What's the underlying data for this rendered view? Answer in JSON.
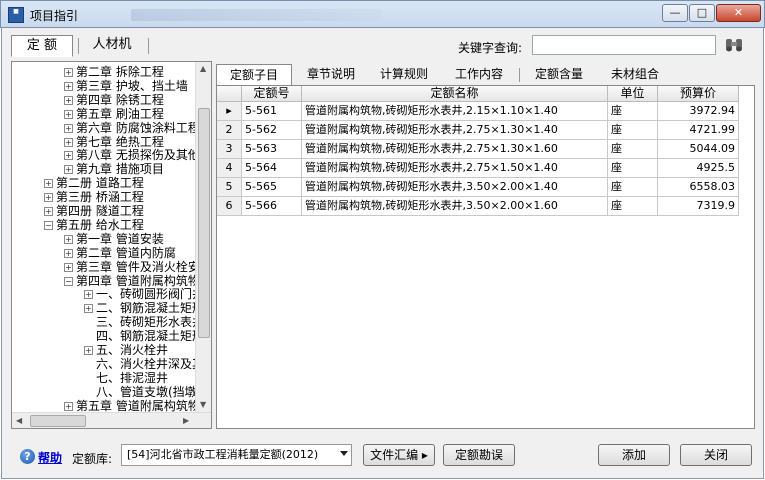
{
  "window": {
    "title": "项目指引"
  },
  "left_tabs": [
    {
      "label": "定 额"
    },
    {
      "label": "人材机"
    }
  ],
  "keyword": {
    "label": "关键字查询:",
    "value": ""
  },
  "tree": [
    {
      "label": "第二章 拆除工程",
      "expander": "+"
    },
    {
      "label": "第三章 护坡、挡土墙",
      "expander": "+"
    },
    {
      "label": "第四章 除锈工程",
      "expander": "+"
    },
    {
      "label": "第五章 刷油工程",
      "expander": "+"
    },
    {
      "label": "第六章 防腐蚀涂料工程",
      "expander": "+"
    },
    {
      "label": "第七章 绝热工程",
      "expander": "+"
    },
    {
      "label": "第八章 无损探伤及其他",
      "expander": "+"
    },
    {
      "label": "第九章 措施项目",
      "expander": "+"
    },
    {
      "label": "第二册 道路工程",
      "expander": "+"
    },
    {
      "label": "第三册 桥涵工程",
      "expander": "+"
    },
    {
      "label": "第四册 隧道工程",
      "expander": "+"
    },
    {
      "label": "第五册 给水工程",
      "expander": "−"
    },
    {
      "label": "第一章 管道安装",
      "expander": "+"
    },
    {
      "label": "第二章 管道内防腐",
      "expander": "+"
    },
    {
      "label": "第三章 管件及消火栓安装",
      "expander": "+"
    },
    {
      "label": "第四章 管道附属构筑物",
      "expander": "−"
    },
    {
      "label": "一、砖砌圆形阀门井",
      "expander": "+"
    },
    {
      "label": "二、钢筋混凝土矩形",
      "expander": "+"
    },
    {
      "label": "三、砖砌矩形水表井",
      "expander": ""
    },
    {
      "label": "四、钢筋混凝土矩形",
      "expander": ""
    },
    {
      "label": "五、消火栓井",
      "expander": "+"
    },
    {
      "label": "六、消火栓井深及其他",
      "expander": ""
    },
    {
      "label": "七、排泥湿井",
      "expander": ""
    },
    {
      "label": "八、管道支墩(挡墩)",
      "expander": ""
    },
    {
      "label": "第五章 管道附属构筑物",
      "expander": "+"
    }
  ],
  "right_tabs": [
    {
      "label": "定额子目"
    },
    {
      "label": "章节说明"
    },
    {
      "label": "计算规则"
    },
    {
      "label": "工作内容"
    },
    {
      "label": "定额含量"
    },
    {
      "label": "未材组合"
    }
  ],
  "grid": {
    "headers": {
      "code": "定额号",
      "name": "定额名称",
      "unit": "单位",
      "price": "预算价"
    },
    "rows": [
      {
        "marker": "▸",
        "code": "5-561",
        "name": "管道附属构筑物,砖砌矩形水表井,2.15×1.10×1.40",
        "unit": "座",
        "price": "3972.94"
      },
      {
        "marker": "2",
        "code": "5-562",
        "name": "管道附属构筑物,砖砌矩形水表井,2.75×1.30×1.40",
        "unit": "座",
        "price": "4721.99"
      },
      {
        "marker": "3",
        "code": "5-563",
        "name": "管道附属构筑物,砖砌矩形水表井,2.75×1.30×1.60",
        "unit": "座",
        "price": "5044.09"
      },
      {
        "marker": "4",
        "code": "5-564",
        "name": "管道附属构筑物,砖砌矩形水表井,2.75×1.50×1.40",
        "unit": "座",
        "price": "4925.5"
      },
      {
        "marker": "5",
        "code": "5-565",
        "name": "管道附属构筑物,砖砌矩形水表井,3.50×2.00×1.40",
        "unit": "座",
        "price": "6558.03"
      },
      {
        "marker": "6",
        "code": "5-566",
        "name": "管道附属构筑物,砖砌矩形水表井,3.50×2.00×1.60",
        "unit": "座",
        "price": "7319.9"
      }
    ]
  },
  "bottom": {
    "help_label": "帮助",
    "library_label": "定额库:",
    "library_value": "[54]河北省市政工程消耗量定额(2012)",
    "summary_button": "文件汇编 ▸",
    "errata_button": "定额勘误",
    "add_button": "添加",
    "close_button": "关闭"
  },
  "colors": {
    "titlebar": "#c9daee",
    "close_button": "#c8462e",
    "help_link": "#0000cc"
  }
}
